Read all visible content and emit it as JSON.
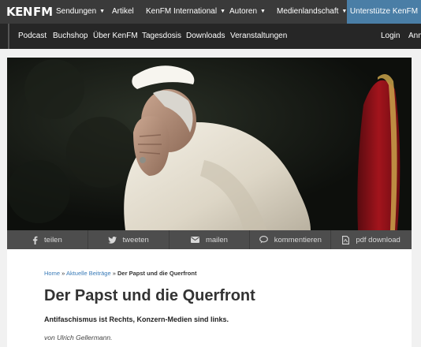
{
  "header": {
    "logo": {
      "part1": "KEN",
      "part2": "FM"
    },
    "nav": [
      {
        "label": "Sendungen",
        "dropdown": true
      },
      {
        "label": "Artikel",
        "dropdown": false
      },
      {
        "label": "KenFM International",
        "dropdown": true
      },
      {
        "label": "Autoren",
        "dropdown": true
      },
      {
        "label": "Medienlandschaft",
        "dropdown": true
      }
    ],
    "support_label": "Unterstütze KenFM"
  },
  "subnav": {
    "items": [
      "Podcast",
      "Buchshop",
      "Über KenFM",
      "Tagesdosis",
      "Downloads",
      "Veranstaltungen"
    ],
    "login": "Login",
    "register_partial": "Anm"
  },
  "share": {
    "items": [
      {
        "label": "teilen",
        "icon": "facebook-icon"
      },
      {
        "label": "tweeten",
        "icon": "twitter-icon"
      },
      {
        "label": "mailen",
        "icon": "mail-icon"
      },
      {
        "label": "kommentieren",
        "icon": "comment-icon"
      },
      {
        "label": "pdf download",
        "icon": "pdf-icon"
      }
    ]
  },
  "article": {
    "breadcrumb": {
      "home": "Home",
      "sep": "»",
      "category": "Aktuelle Beiträge",
      "current": "Der Papst und die Querfront"
    },
    "title": "Der Papst und die Querfront",
    "subtitle": "Antifaschismus ist Rechts, Konzern-Medien sind links.",
    "author": "von Ulrich Gellermann."
  },
  "colors": {
    "topnav_bg": "#3a3a3a",
    "subnav_bg": "#262626",
    "support_bg": "#4a7ea6",
    "sharebar_bg": "#4d4d4d",
    "link": "#3a7bb8"
  }
}
